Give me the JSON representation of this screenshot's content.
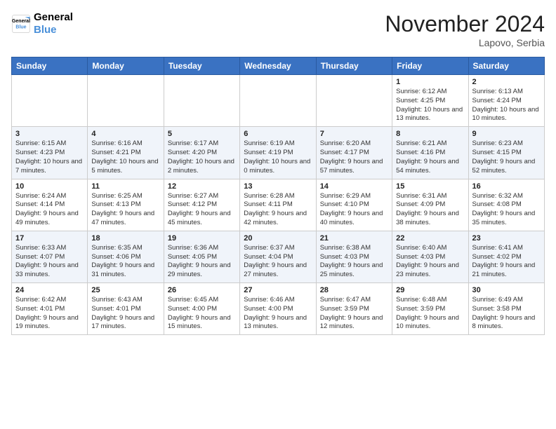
{
  "logo": {
    "line1": "General",
    "line2": "Blue"
  },
  "title": "November 2024",
  "location": "Lapovo, Serbia",
  "days_of_week": [
    "Sunday",
    "Monday",
    "Tuesday",
    "Wednesday",
    "Thursday",
    "Friday",
    "Saturday"
  ],
  "weeks": [
    [
      {
        "day": "",
        "info": ""
      },
      {
        "day": "",
        "info": ""
      },
      {
        "day": "",
        "info": ""
      },
      {
        "day": "",
        "info": ""
      },
      {
        "day": "",
        "info": ""
      },
      {
        "day": "1",
        "info": "Sunrise: 6:12 AM\nSunset: 4:25 PM\nDaylight: 10 hours and 13 minutes."
      },
      {
        "day": "2",
        "info": "Sunrise: 6:13 AM\nSunset: 4:24 PM\nDaylight: 10 hours and 10 minutes."
      }
    ],
    [
      {
        "day": "3",
        "info": "Sunrise: 6:15 AM\nSunset: 4:23 PM\nDaylight: 10 hours and 7 minutes."
      },
      {
        "day": "4",
        "info": "Sunrise: 6:16 AM\nSunset: 4:21 PM\nDaylight: 10 hours and 5 minutes."
      },
      {
        "day": "5",
        "info": "Sunrise: 6:17 AM\nSunset: 4:20 PM\nDaylight: 10 hours and 2 minutes."
      },
      {
        "day": "6",
        "info": "Sunrise: 6:19 AM\nSunset: 4:19 PM\nDaylight: 10 hours and 0 minutes."
      },
      {
        "day": "7",
        "info": "Sunrise: 6:20 AM\nSunset: 4:17 PM\nDaylight: 9 hours and 57 minutes."
      },
      {
        "day": "8",
        "info": "Sunrise: 6:21 AM\nSunset: 4:16 PM\nDaylight: 9 hours and 54 minutes."
      },
      {
        "day": "9",
        "info": "Sunrise: 6:23 AM\nSunset: 4:15 PM\nDaylight: 9 hours and 52 minutes."
      }
    ],
    [
      {
        "day": "10",
        "info": "Sunrise: 6:24 AM\nSunset: 4:14 PM\nDaylight: 9 hours and 49 minutes."
      },
      {
        "day": "11",
        "info": "Sunrise: 6:25 AM\nSunset: 4:13 PM\nDaylight: 9 hours and 47 minutes."
      },
      {
        "day": "12",
        "info": "Sunrise: 6:27 AM\nSunset: 4:12 PM\nDaylight: 9 hours and 45 minutes."
      },
      {
        "day": "13",
        "info": "Sunrise: 6:28 AM\nSunset: 4:11 PM\nDaylight: 9 hours and 42 minutes."
      },
      {
        "day": "14",
        "info": "Sunrise: 6:29 AM\nSunset: 4:10 PM\nDaylight: 9 hours and 40 minutes."
      },
      {
        "day": "15",
        "info": "Sunrise: 6:31 AM\nSunset: 4:09 PM\nDaylight: 9 hours and 38 minutes."
      },
      {
        "day": "16",
        "info": "Sunrise: 6:32 AM\nSunset: 4:08 PM\nDaylight: 9 hours and 35 minutes."
      }
    ],
    [
      {
        "day": "17",
        "info": "Sunrise: 6:33 AM\nSunset: 4:07 PM\nDaylight: 9 hours and 33 minutes."
      },
      {
        "day": "18",
        "info": "Sunrise: 6:35 AM\nSunset: 4:06 PM\nDaylight: 9 hours and 31 minutes."
      },
      {
        "day": "19",
        "info": "Sunrise: 6:36 AM\nSunset: 4:05 PM\nDaylight: 9 hours and 29 minutes."
      },
      {
        "day": "20",
        "info": "Sunrise: 6:37 AM\nSunset: 4:04 PM\nDaylight: 9 hours and 27 minutes."
      },
      {
        "day": "21",
        "info": "Sunrise: 6:38 AM\nSunset: 4:03 PM\nDaylight: 9 hours and 25 minutes."
      },
      {
        "day": "22",
        "info": "Sunrise: 6:40 AM\nSunset: 4:03 PM\nDaylight: 9 hours and 23 minutes."
      },
      {
        "day": "23",
        "info": "Sunrise: 6:41 AM\nSunset: 4:02 PM\nDaylight: 9 hours and 21 minutes."
      }
    ],
    [
      {
        "day": "24",
        "info": "Sunrise: 6:42 AM\nSunset: 4:01 PM\nDaylight: 9 hours and 19 minutes."
      },
      {
        "day": "25",
        "info": "Sunrise: 6:43 AM\nSunset: 4:01 PM\nDaylight: 9 hours and 17 minutes."
      },
      {
        "day": "26",
        "info": "Sunrise: 6:45 AM\nSunset: 4:00 PM\nDaylight: 9 hours and 15 minutes."
      },
      {
        "day": "27",
        "info": "Sunrise: 6:46 AM\nSunset: 4:00 PM\nDaylight: 9 hours and 13 minutes."
      },
      {
        "day": "28",
        "info": "Sunrise: 6:47 AM\nSunset: 3:59 PM\nDaylight: 9 hours and 12 minutes."
      },
      {
        "day": "29",
        "info": "Sunrise: 6:48 AM\nSunset: 3:59 PM\nDaylight: 9 hours and 10 minutes."
      },
      {
        "day": "30",
        "info": "Sunrise: 6:49 AM\nSunset: 3:58 PM\nDaylight: 9 hours and 8 minutes."
      }
    ]
  ]
}
